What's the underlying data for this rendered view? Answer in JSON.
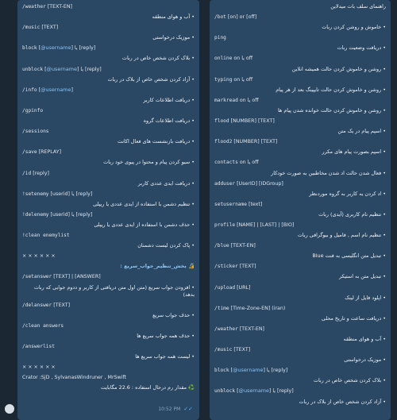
{
  "left": {
    "rows": [
      {
        "type": "cmd",
        "parts": [
          {
            "t": "/weather",
            "k": "mono"
          },
          {
            "t": " [TEXT-EN]",
            "k": "arg"
          }
        ]
      },
      {
        "type": "desc",
        "text": "• آب و هوای منطقه"
      },
      {
        "type": "cmd",
        "parts": [
          {
            "t": "/music",
            "k": "mono"
          },
          {
            "t": " [TEXT]",
            "k": "arg"
          }
        ]
      },
      {
        "type": "desc",
        "text": "• موزیک درخواستی"
      },
      {
        "type": "cmd",
        "parts": [
          {
            "t": "block",
            "k": "mono"
          },
          {
            "t": " [",
            "k": "arg"
          },
          {
            "t": "@username",
            "k": "link"
          },
          {
            "t": "] یا [reply]",
            "k": "arg"
          }
        ]
      },
      {
        "type": "desc",
        "text": "• بلاک کردن شخص خاص در ربات"
      },
      {
        "type": "cmd",
        "parts": [
          {
            "t": "unblock",
            "k": "mono"
          },
          {
            "t": " [",
            "k": "arg"
          },
          {
            "t": "@username",
            "k": "link"
          },
          {
            "t": "] یا [reply]",
            "k": "arg"
          }
        ]
      },
      {
        "type": "desc",
        "text": "• آزاد کردن شخص خاص از بلاک در ربات"
      },
      {
        "type": "cmd",
        "parts": [
          {
            "t": "/info",
            "k": "mono"
          },
          {
            "t": " [",
            "k": "arg"
          },
          {
            "t": "@username",
            "k": "link"
          },
          {
            "t": "]",
            "k": "arg"
          }
        ]
      },
      {
        "type": "desc",
        "text": "• دریافت اطلاعات کاربر"
      },
      {
        "type": "cmd",
        "parts": [
          {
            "t": "/gpinfo",
            "k": "mono"
          }
        ]
      },
      {
        "type": "desc",
        "text": "• دریافت اطلاعات گروه"
      },
      {
        "type": "cmd",
        "parts": [
          {
            "t": "/sessions",
            "k": "mono"
          }
        ]
      },
      {
        "type": "desc",
        "text": "• دریافت بازنشست های فعال اکانت"
      },
      {
        "type": "cmd",
        "parts": [
          {
            "t": "/save",
            "k": "mono"
          },
          {
            "t": " [REPLAY]",
            "k": "arg"
          }
        ]
      },
      {
        "type": "desc",
        "text": "• سیو کردن پیام و محتوا در پیوی خود ربات"
      },
      {
        "type": "cmd",
        "parts": [
          {
            "t": "/id",
            "k": "mono"
          },
          {
            "t": " [reply]",
            "k": "arg"
          }
        ]
      },
      {
        "type": "desc",
        "text": "• دریافت ایدی عددی کاربر"
      },
      {
        "type": "cmd",
        "parts": [
          {
            "t": "!setenemy",
            "k": "mono"
          },
          {
            "t": " [userid] یا [reply]",
            "k": "arg"
          }
        ]
      },
      {
        "type": "desc",
        "text": "• تنظیم دشمن با استفاده از ایدی عددی یا ریپلی"
      },
      {
        "type": "cmd",
        "parts": [
          {
            "t": "!delenemy",
            "k": "mono"
          },
          {
            "t": " [userid] یا [reply]",
            "k": "arg"
          }
        ]
      },
      {
        "type": "desc",
        "text": "• حذف دشمن با استفاده از ایدی عددی یا ریپلی"
      },
      {
        "type": "cmd",
        "parts": [
          {
            "t": "!clean enemylist",
            "k": "mono"
          }
        ]
      },
      {
        "type": "desc",
        "text": "• پاک کردن لیست دشمنان"
      },
      {
        "type": "cmd",
        "parts": [
          {
            "t": "× × × × × ×",
            "k": "arg"
          }
        ]
      },
      {
        "type": "section",
        "text": "🔏 بخش_تنظیم_جواب_سریع :"
      },
      {
        "type": "cmd",
        "parts": [
          {
            "t": "/setanswer",
            "k": "mono"
          },
          {
            "t": " [TEXT] | [ANSWER]",
            "k": "arg"
          }
        ]
      },
      {
        "type": "descwrap",
        "text": "• افزودن جواب سریع (متن اول متن دریافتی از کاربر و ددوم جوابی که ربات بدهد)"
      },
      {
        "type": "cmd",
        "parts": [
          {
            "t": "/delanswer",
            "k": "mono"
          },
          {
            "t": " [TEXT]",
            "k": "arg"
          }
        ]
      },
      {
        "type": "desc",
        "text": "• حذف جواب سریع"
      },
      {
        "type": "cmd",
        "parts": [
          {
            "t": "/clean answers",
            "k": "mono"
          }
        ]
      },
      {
        "type": "desc",
        "text": "• حذف همه جواب سریع ها"
      },
      {
        "type": "cmd",
        "parts": [
          {
            "t": "/answerlist",
            "k": "mono"
          }
        ]
      },
      {
        "type": "desc",
        "text": "• لیست همه جواب سریع ها"
      },
      {
        "type": "cmd",
        "parts": [
          {
            "t": "× × × × × ×",
            "k": "arg"
          }
        ]
      },
      {
        "type": "cmd",
        "parts": [
          {
            "t": "Crator :SjD , SylvanasWindruner , MrSwift",
            "k": "arg"
          }
        ]
      },
      {
        "type": "desc",
        "text": "♻️ مقدار رم درحال استفاده : 22.6 مگابایت"
      }
    ],
    "time": "10:52 PM",
    "check": "✓✓"
  },
  "right": {
    "rows": [
      {
        "type": "desc",
        "text": "راهنمای سلف بات میدلاین"
      },
      {
        "type": "cmd",
        "parts": [
          {
            "t": "/bot",
            "k": "mono"
          },
          {
            "t": " [on] or [off]",
            "k": "arg"
          }
        ]
      },
      {
        "type": "desc",
        "text": "• خاموش و روشن کردن ربات"
      },
      {
        "type": "cmd",
        "parts": [
          {
            "t": "ping",
            "k": "mono"
          }
        ]
      },
      {
        "type": "desc",
        "text": "• دریافت وضعیت ربات"
      },
      {
        "type": "cmd",
        "parts": [
          {
            "t": "online",
            "k": "mono"
          },
          {
            "t": " on یا off",
            "k": "arg"
          }
        ]
      },
      {
        "type": "desc",
        "text": "• روشن و خاموش کردن حالت همیشه انلاین"
      },
      {
        "type": "cmd",
        "parts": [
          {
            "t": "typing",
            "k": "mono"
          },
          {
            "t": " on یا off",
            "k": "arg"
          }
        ]
      },
      {
        "type": "desc",
        "text": "• روشن و خاموش کردن حالت تایپینگ بعد از هر پیام"
      },
      {
        "type": "cmd",
        "parts": [
          {
            "t": "markread",
            "k": "mono"
          },
          {
            "t": " on یا off",
            "k": "arg"
          }
        ]
      },
      {
        "type": "desc",
        "text": "• روشن و خاموش کردن حالت خوانده شدن پیام ها"
      },
      {
        "type": "cmd",
        "parts": [
          {
            "t": "flood",
            "k": "mono"
          },
          {
            "t": " [NUMBER] [TEXT]",
            "k": "arg"
          }
        ]
      },
      {
        "type": "desc",
        "text": "• اسپم پیام در یک متن"
      },
      {
        "type": "cmd",
        "parts": [
          {
            "t": "flood2",
            "k": "mono"
          },
          {
            "t": " [NUMBER] [TEXT]",
            "k": "arg"
          }
        ]
      },
      {
        "type": "desc",
        "text": "• اسپم بصورت پیام های مکرر"
      },
      {
        "type": "cmd",
        "parts": [
          {
            "t": "contacts",
            "k": "mono"
          },
          {
            "t": " on یا off",
            "k": "arg"
          }
        ]
      },
      {
        "type": "desc",
        "text": "• فعال شدن حالت اد شدن مخاطبین به صورت خودکار"
      },
      {
        "type": "cmd",
        "parts": [
          {
            "t": "adduser",
            "k": "mono"
          },
          {
            "t": " [UserID] [IDGroup]",
            "k": "arg"
          }
        ]
      },
      {
        "type": "desc",
        "text": "• اد کردن یه کاربر به گروه موردنظر"
      },
      {
        "type": "cmd",
        "parts": [
          {
            "t": "setusername",
            "k": "mono"
          },
          {
            "t": " [text]",
            "k": "arg"
          }
        ]
      },
      {
        "type": "desc",
        "text": "• تنظیم نام کاربری (آیدی) ربات"
      },
      {
        "type": "cmd",
        "parts": [
          {
            "t": "profile",
            "k": "mono"
          },
          {
            "t": " [NAME] | [LAST] | [BIO]",
            "k": "arg"
          }
        ]
      },
      {
        "type": "desc",
        "text": "• تنظیم نام اسم , فامیل و بیوگرافی ربات"
      },
      {
        "type": "cmd",
        "parts": [
          {
            "t": "/blue",
            "k": "mono"
          },
          {
            "t": " [TEXT-EN]",
            "k": "arg"
          }
        ]
      },
      {
        "type": "desc",
        "text": "• تبدیل متن انگلیسی به فنت Blue"
      },
      {
        "type": "cmd",
        "parts": [
          {
            "t": "/sticker",
            "k": "mono"
          },
          {
            "t": " [TEXT]",
            "k": "arg"
          }
        ]
      },
      {
        "type": "desc",
        "text": "• تبدیل متن به استیکر"
      },
      {
        "type": "cmd",
        "parts": [
          {
            "t": "/upload",
            "k": "mono"
          },
          {
            "t": " [URL]",
            "k": "arg"
          }
        ]
      },
      {
        "type": "desc",
        "text": "• اپلود فایل از لینک"
      },
      {
        "type": "cmd",
        "parts": [
          {
            "t": "/time",
            "k": "mono"
          },
          {
            "t": " [Time-Zone-EN] (iran)",
            "k": "arg"
          }
        ]
      },
      {
        "type": "desc",
        "text": "• دریافت ساعت و تاریخ محلی"
      },
      {
        "type": "cmd",
        "parts": [
          {
            "t": "/weather",
            "k": "mono"
          },
          {
            "t": " [TEXT-EN]",
            "k": "arg"
          }
        ]
      },
      {
        "type": "desc",
        "text": "• آب و هوای منطقه"
      },
      {
        "type": "cmd",
        "parts": [
          {
            "t": "/music",
            "k": "mono"
          },
          {
            "t": " [TEXT]",
            "k": "arg"
          }
        ]
      },
      {
        "type": "desc",
        "text": "• موزیک درخواستی"
      },
      {
        "type": "cmd",
        "parts": [
          {
            "t": "block",
            "k": "mono"
          },
          {
            "t": " [",
            "k": "arg"
          },
          {
            "t": "@username",
            "k": "link"
          },
          {
            "t": "] یا [reply]",
            "k": "arg"
          }
        ]
      },
      {
        "type": "desc",
        "text": "• بلاک کردن شخص خاص در ربات"
      },
      {
        "type": "cmd",
        "parts": [
          {
            "t": "unblock",
            "k": "mono"
          },
          {
            "t": " [",
            "k": "arg"
          },
          {
            "t": "@username",
            "k": "link"
          },
          {
            "t": "] یا [reply]",
            "k": "arg"
          }
        ]
      },
      {
        "type": "desc",
        "text": "• آزاد کردن شخص خاص از بلاک در ربات"
      }
    ]
  },
  "colors": {
    "background": "#1b2733",
    "bubble": "#2a4763",
    "link": "#8ec5f5",
    "check": "#5fb0f5"
  }
}
